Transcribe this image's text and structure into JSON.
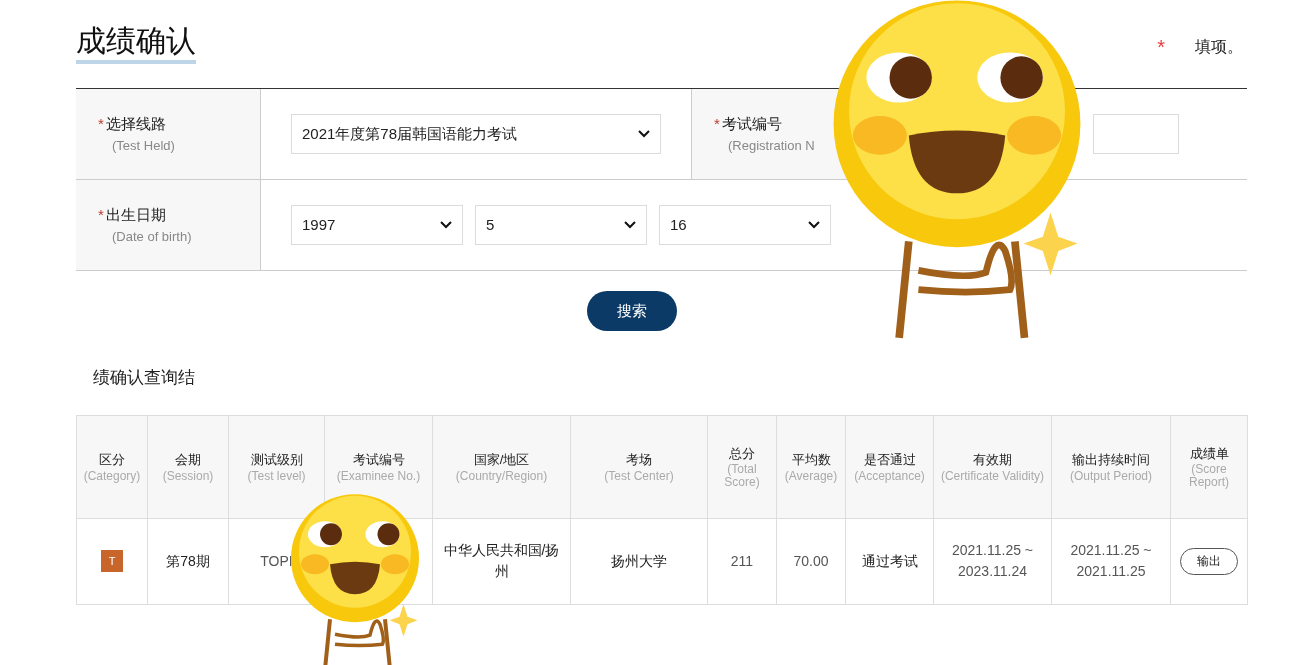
{
  "title": "成绩确认",
  "required_note": {
    "mark": "*",
    "text": "填项。"
  },
  "form": {
    "rows": [
      {
        "fields": [
          {
            "kind": "select",
            "label": "选择线路",
            "sublabel": "(Test Held)",
            "values": [
              "2021年度第78届韩国语能力考试"
            ]
          },
          {
            "kind": "input",
            "label": "考试编号",
            "sublabel": "(Registration N"
          }
        ]
      },
      {
        "fields": [
          {
            "kind": "date",
            "label": "出生日期",
            "sublabel": "(Date of birth)",
            "values": [
              "1997",
              "5",
              "16"
            ]
          }
        ]
      }
    ]
  },
  "search_button": "搜索",
  "results_title": "绩确认查询结",
  "table": {
    "columns": [
      {
        "label": "区分",
        "sublabel": "(Category)"
      },
      {
        "label": "会期",
        "sublabel": "(Session)"
      },
      {
        "label": "测试级别",
        "sublabel": "(Test level)"
      },
      {
        "label": "考试编号",
        "sublabel": "(Examinee No.)"
      },
      {
        "label": "国家/地区",
        "sublabel": "(Country/Region)"
      },
      {
        "label": "考场",
        "sublabel": "(Test Center)"
      },
      {
        "label": "总分",
        "sublabel": "(Total Score)"
      },
      {
        "label": "平均数",
        "sublabel": "(Average)"
      },
      {
        "label": "是否通过",
        "sublabel": "(Acceptance)"
      },
      {
        "label": "有效期",
        "sublabel": "(Certificate Validity)"
      },
      {
        "label": "输出持续时间",
        "sublabel": "(Output Period)"
      },
      {
        "label": "成绩单",
        "sublabel": "(Score Report)"
      }
    ],
    "rows": [
      {
        "cells": [
          {
            "kind": "badge",
            "text": "T"
          },
          {
            "kind": "text",
            "text": "第78期"
          },
          {
            "kind": "muted",
            "text": "TOPI"
          },
          {
            "kind": "text",
            "text": ""
          },
          {
            "kind": "text",
            "text": "中华人民共和国/扬州"
          },
          {
            "kind": "text",
            "text": "扬州大学"
          },
          {
            "kind": "muted",
            "text": "211"
          },
          {
            "kind": "muted",
            "text": "70.00"
          },
          {
            "kind": "text",
            "text": "通过考试"
          },
          {
            "kind": "muted",
            "text": "2021.11.25 ~ 2023.11.24"
          },
          {
            "kind": "muted",
            "text": "2021.11.25 ~ 2021.11.25"
          },
          {
            "kind": "button",
            "text": "输出"
          }
        ]
      }
    ]
  }
}
